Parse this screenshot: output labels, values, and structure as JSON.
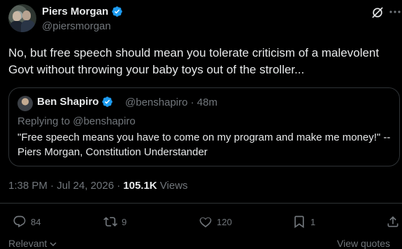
{
  "author": {
    "name": "Piers Morgan",
    "handle": "@piersmorgan"
  },
  "tweet": {
    "text": "No, but free speech should mean you tolerate criticism of a malevolent Govt without throwing your baby toys out of the stroller..."
  },
  "quote": {
    "name": "Ben Shapiro",
    "meta": "@benshapiro · 48m",
    "reply": "Replying to @benshapiro",
    "text": "\"Free speech means you have to come on my program and make me money!\" -- Piers Morgan, Constitution Understander"
  },
  "meta": {
    "timestamp": "1:38 PM · Jul 24, 2026 · ",
    "views_count": "105.1K",
    "views_label": " Views"
  },
  "actions": {
    "replies": "84",
    "reposts": "9",
    "likes": "120",
    "bookmarks": "1"
  },
  "footer": {
    "relevant": "Relevant",
    "view_quotes": "View quotes"
  },
  "colors": {
    "background": "#000000",
    "text": "#e7e9ea",
    "muted": "#71767b",
    "border": "#2f3336",
    "verified": "#1d9bf0"
  },
  "icons": [
    "verified-badge-icon",
    "grok-icon",
    "more-icon",
    "reply-icon",
    "repost-icon",
    "like-icon",
    "bookmark-icon",
    "share-icon",
    "chevron-down-icon"
  ]
}
